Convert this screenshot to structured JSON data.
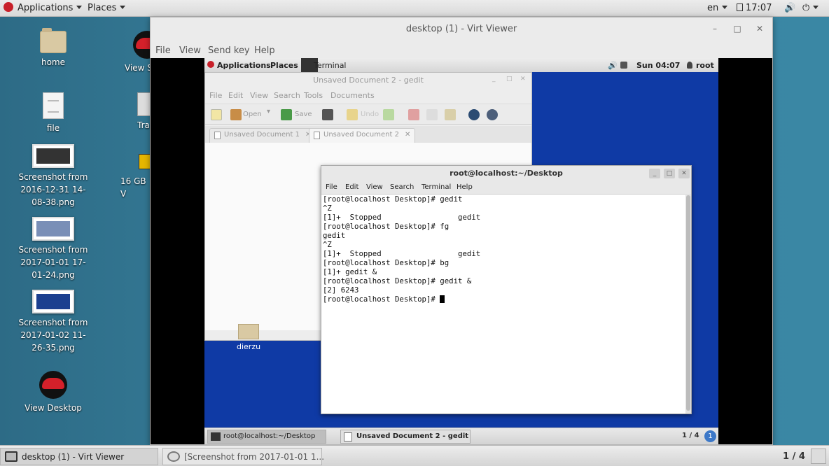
{
  "host_top_bar": {
    "applications": "Applications",
    "places": "Places",
    "lang": "en",
    "clock": "17:07"
  },
  "desktop_icons": [
    {
      "label": "home",
      "icon": "folder-icon"
    },
    {
      "label": "file",
      "icon": "file-icon"
    },
    {
      "label": "Screenshot from 2016-12-31 14-08-38.png",
      "icon": "image-thumbnail"
    },
    {
      "label": "Screenshot from 2017-01-01 17-01-24.png",
      "icon": "image-thumbnail"
    },
    {
      "label": "Screenshot from 2017-01-02 11-26-35.png",
      "icon": "image-thumbnail"
    },
    {
      "label": "View Desktop",
      "icon": "redhat-icon"
    },
    {
      "label": "View S",
      "icon": "redhat-icon"
    },
    {
      "label": "Tra",
      "icon": "trash-icon"
    },
    {
      "label": "16 GB V",
      "icon": "drive-icon"
    }
  ],
  "virt_viewer": {
    "title": "desktop (1) - Virt Viewer",
    "menu": [
      "File",
      "View",
      "Send key",
      "Help"
    ]
  },
  "guest": {
    "top_bar": {
      "applications": "Applications",
      "places": "Places",
      "terminal": "Terminal",
      "clock": "Sun 04:07",
      "user": "root"
    },
    "gedit": {
      "title": "Unsaved Document 2 - gedit",
      "menu": [
        "File",
        "Edit",
        "View",
        "Search",
        "Tools",
        "Documents"
      ],
      "toolbar": {
        "open": "Open",
        "save": "Save",
        "undo": "Undo"
      },
      "tabs": [
        "Unsaved Document 1",
        "Unsaved Document 2"
      ]
    },
    "desktop_folder": "dierzu",
    "terminal": {
      "title": "root@localhost:~/Desktop",
      "menu": [
        "File",
        "Edit",
        "View",
        "Search",
        "Terminal",
        "Help"
      ],
      "lines": [
        "[root@localhost Desktop]# gedit",
        "^Z",
        "[1]+  Stopped                 gedit",
        "[root@localhost Desktop]# fg",
        "gedit",
        "^Z",
        "[1]+  Stopped                 gedit",
        "[root@localhost Desktop]# bg",
        "[1]+ gedit &",
        "[root@localhost Desktop]# gedit &",
        "[2] 6243",
        "[root@localhost Desktop]# "
      ]
    },
    "taskbar": {
      "items": [
        "root@localhost:~/Desktop",
        "Unsaved Document 2 - gedit"
      ],
      "workspace": "1 / 4"
    }
  },
  "host_taskbar": {
    "items": [
      "desktop (1) - Virt Viewer",
      "[Screenshot from 2017-01-01 1..."
    ],
    "workspace": "1 / 4"
  }
}
